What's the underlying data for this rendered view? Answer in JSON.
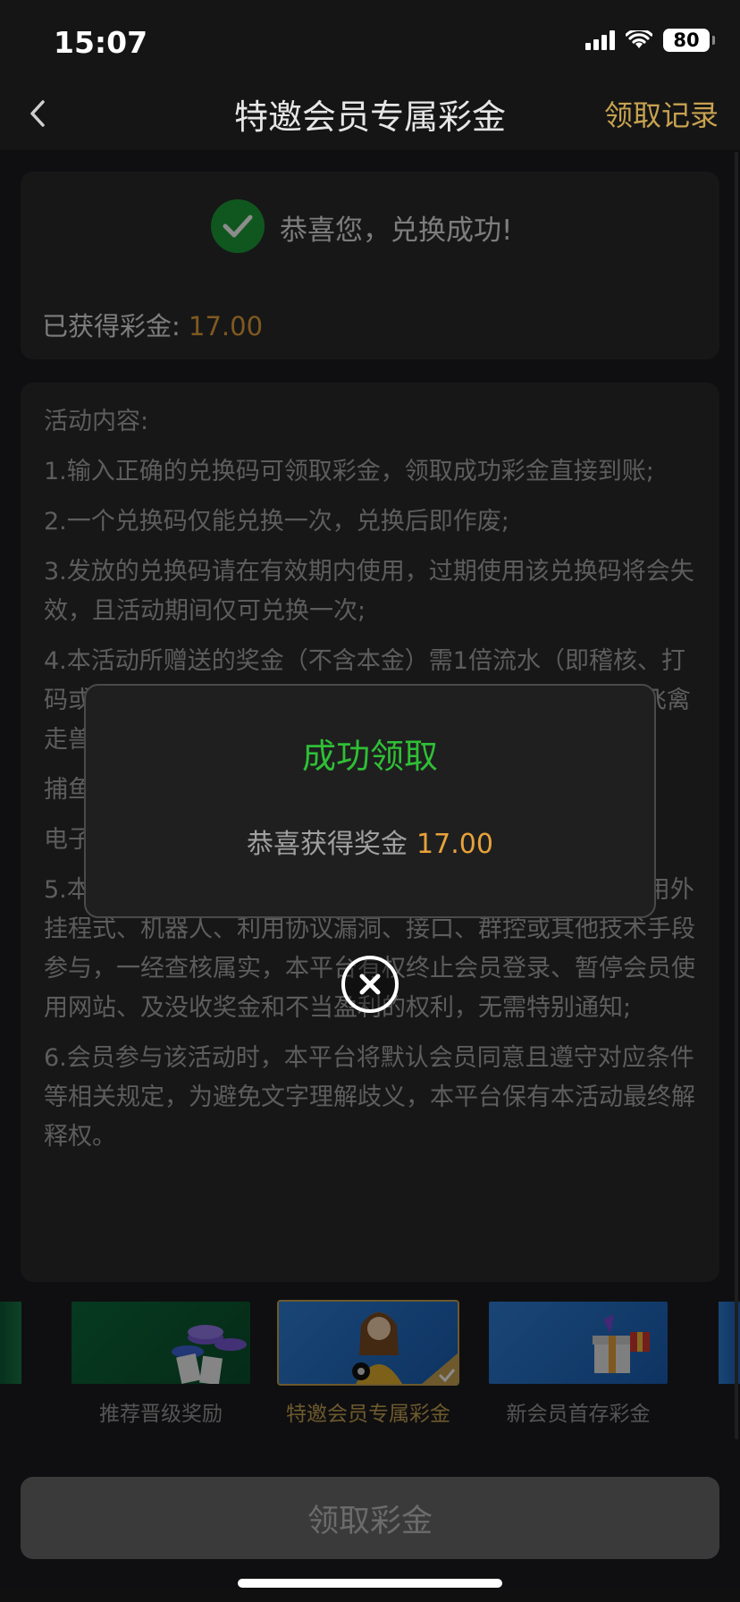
{
  "status_bar": {
    "time": "15:07",
    "battery": "80"
  },
  "nav": {
    "title": "特邀会员专属彩金",
    "right_link": "领取记录"
  },
  "result": {
    "message": "恭喜您，兑换成功!",
    "earned_label": "已获得彩金:",
    "earned_value": "17.00"
  },
  "rules": {
    "heading": "活动内容:",
    "items": [
      "1.输入正确的兑换码可领取彩金，领取成功彩金直接到账;",
      "2.一个兑换码仅能兑换一次，兑换后即作废;",
      "3.发放的兑换码请在有效期内使用，过期使用该兑换码将会失效，且活动期间仅可兑换一次;",
      "4.本活动所赠送的奖金（不含本金）需1倍流水（即稽核、打码或有效投注）才能提现，打码仅限棋牌:WG(百人牛牛,飞禽走兽",
      "捕鱼",
      "电子",
      "5.本活动仅限账号本人领取奖励，禁止租借账号，不得使用外挂程式、机器人、利用协议漏洞、接口、群控或其他技术手段参与，一经查核属实，本平台有权终止会员登录、暂停会员使用网站、及没收奖金和不当盈利的权利，无需特别通知;",
      "6.会员参与该活动时，本平台将默认会员同意且遵守对应条件等相关规定，为避免文字理解歧义，本平台保有本活动最终解释权。"
    ]
  },
  "tabs": [
    {
      "label": "推荐晋级奖励",
      "active": false
    },
    {
      "label": "特邀会员专属彩金",
      "active": true
    },
    {
      "label": "新会员首存彩金",
      "active": false
    }
  ],
  "bottom_button": "领取彩金",
  "dialog": {
    "title": "成功领取",
    "message": "恭喜获得奖金",
    "amount": "17.00"
  },
  "colors": {
    "accent_gold": "#c7a250",
    "amount_orange": "#e8a23a",
    "success_green": "#2fbf35"
  }
}
